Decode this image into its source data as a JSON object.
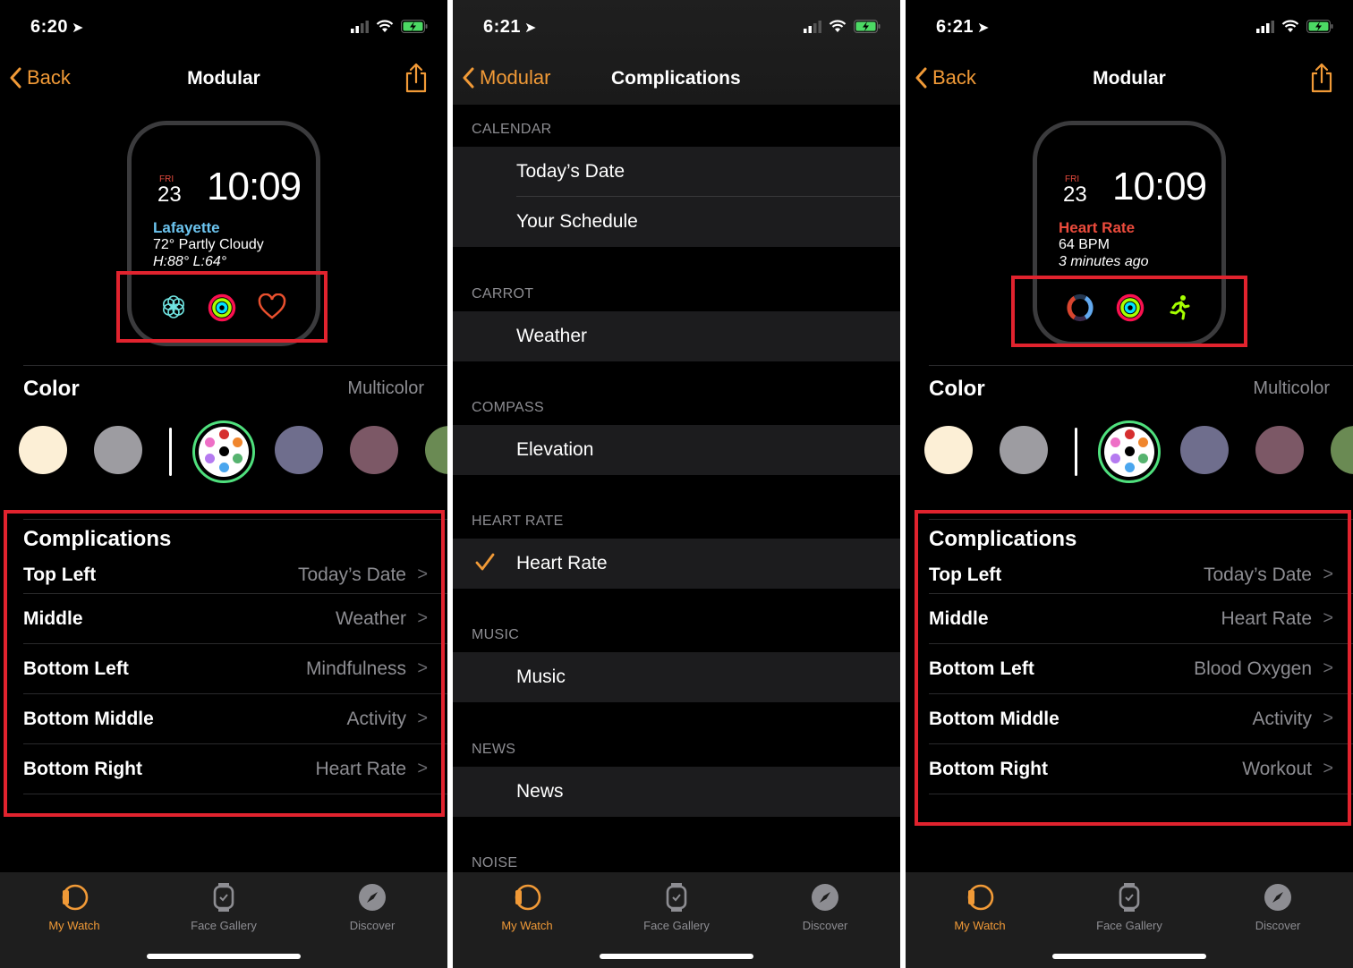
{
  "colors": {
    "accent": "#f19a37",
    "highlight_box": "#e1232e",
    "selected_ring": "#4fe07d"
  },
  "screens": [
    {
      "status": {
        "time": "6:20"
      },
      "nav": {
        "back_label": "Back",
        "title": "Modular"
      },
      "watch": {
        "day": "FRI",
        "date": "23",
        "time": "10:09",
        "line1": "Lafayette",
        "line1_color": "#6cc4ef",
        "line2": "72° Partly Cloudy",
        "line3": "H:88° L:64°",
        "complications": [
          "mindfulness-icon",
          "activity-rings-icon",
          "heart-icon"
        ]
      },
      "color": {
        "label": "Color",
        "value": "Multicolor"
      },
      "complications": {
        "header": "Complications",
        "rows": [
          {
            "slot": "Top Left",
            "value": "Today’s Date"
          },
          {
            "slot": "Middle",
            "value": "Weather"
          },
          {
            "slot": "Bottom Left",
            "value": "Mindfulness"
          },
          {
            "slot": "Bottom Middle",
            "value": "Activity"
          },
          {
            "slot": "Bottom Right",
            "value": "Heart Rate"
          }
        ]
      }
    },
    {
      "status": {
        "time": "6:21"
      },
      "nav": {
        "back_label": "Modular",
        "title": "Complications"
      },
      "sections": [
        {
          "header": "CALENDAR",
          "items": [
            {
              "label": "Today’s Date",
              "checked": false
            },
            {
              "label": "Your Schedule",
              "checked": false
            }
          ]
        },
        {
          "header": "CARROT",
          "items": [
            {
              "label": "Weather",
              "checked": false
            }
          ]
        },
        {
          "header": "COMPASS",
          "items": [
            {
              "label": "Elevation",
              "checked": false
            }
          ]
        },
        {
          "header": "HEART RATE",
          "items": [
            {
              "label": "Heart Rate",
              "checked": true
            }
          ]
        },
        {
          "header": "MUSIC",
          "items": [
            {
              "label": "Music",
              "checked": false
            }
          ]
        },
        {
          "header": "NEWS",
          "items": [
            {
              "label": "News",
              "checked": false
            }
          ]
        },
        {
          "header": "NOISE",
          "items": []
        }
      ]
    },
    {
      "status": {
        "time": "6:21"
      },
      "nav": {
        "back_label": "Back",
        "title": "Modular"
      },
      "watch": {
        "day": "FRI",
        "date": "23",
        "time": "10:09",
        "line1": "Heart Rate",
        "line1_color": "#ec4b3c",
        "line2": "64 BPM",
        "line3": "3 minutes ago",
        "complications": [
          "blood-oxygen-icon",
          "activity-rings-icon",
          "workout-runner-icon"
        ]
      },
      "color": {
        "label": "Color",
        "value": "Multicolor"
      },
      "complications": {
        "header": "Complications",
        "rows": [
          {
            "slot": "Top Left",
            "value": "Today’s Date"
          },
          {
            "slot": "Middle",
            "value": "Heart Rate"
          },
          {
            "slot": "Bottom Left",
            "value": "Blood Oxygen"
          },
          {
            "slot": "Bottom Middle",
            "value": "Activity"
          },
          {
            "slot": "Bottom Right",
            "value": "Workout"
          }
        ]
      }
    }
  ],
  "swatches": [
    "#fcefd6",
    "#9d9ca1",
    "multicolor",
    "#6f6e8d",
    "#7c5866",
    "#6a8a53"
  ],
  "tabbar": [
    {
      "label": "My Watch",
      "icon": "my-watch-icon",
      "active": true
    },
    {
      "label": "Face Gallery",
      "icon": "face-gallery-icon",
      "active": false
    },
    {
      "label": "Discover",
      "icon": "discover-compass-icon",
      "active": false
    }
  ]
}
